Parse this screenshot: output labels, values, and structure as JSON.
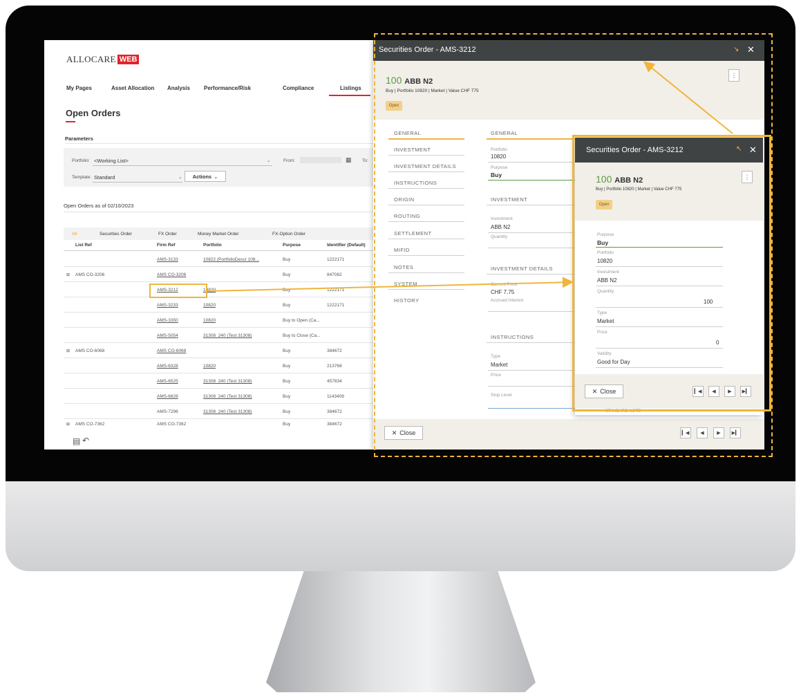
{
  "app": {
    "logo_text": "ALLOCARE",
    "logo_badge": "WEB",
    "nav": [
      "My Pages",
      "Asset Allocation",
      "Analysis",
      "Performance/Risk",
      "Compliance",
      "Listings"
    ],
    "page_title": "Open Orders",
    "parameters_label": "Parameters",
    "portfolio_label": "Portfolio:",
    "portfolio_value": "<Working List>",
    "template_label": "Template:",
    "template_value": "Standard",
    "actions_label": "Actions",
    "from_label": "From:",
    "to_label": "To:",
    "orders_as_of": "Open Orders as of 02/10/2023",
    "tabs": [
      "All",
      "Securities Order",
      "FX Order",
      "Money Market Order",
      "FX-Option Order"
    ],
    "columns": [
      "List Ref",
      "Firm Ref",
      "Portfolio",
      "Purpose",
      "Identifier (Default)"
    ],
    "rows": [
      {
        "list_ref": "",
        "firm_ref": "AMS-3133",
        "portfolio": "10822 (PortfolioDescr 108...",
        "purpose": "Buy",
        "identifier": "1222171"
      },
      {
        "list_ref": "AMS CO-3206",
        "firm_ref": "AMS CO-3206",
        "portfolio": "",
        "purpose": "Buy",
        "identifier": "847082"
      },
      {
        "list_ref": "",
        "firm_ref": "AMS-3212",
        "portfolio": "10820",
        "purpose": "Buy",
        "identifier": "1222171"
      },
      {
        "list_ref": "",
        "firm_ref": "AMS-3233",
        "portfolio": "10820",
        "purpose": "Buy",
        "identifier": "1222171"
      },
      {
        "list_ref": "",
        "firm_ref": "AMS-3350",
        "portfolio": "10820",
        "purpose": "Buy to Open (Ca...",
        "identifier": ""
      },
      {
        "list_ref": "",
        "firm_ref": "AMS-5054",
        "portfolio": "31308_240 (Test 31308)",
        "purpose": "Buy to Close (Ca...",
        "identifier": ""
      },
      {
        "list_ref": "AMS CO-6068",
        "firm_ref": "AMS CO-6068",
        "portfolio": "",
        "purpose": "Buy",
        "identifier": "384672"
      },
      {
        "list_ref": "",
        "firm_ref": "AMS-6328",
        "portfolio": "10820",
        "purpose": "Buy",
        "identifier": "213768"
      },
      {
        "list_ref": "",
        "firm_ref": "AMS-6525",
        "portfolio": "31308_240 (Test 31308)",
        "purpose": "Buy",
        "identifier": "457834"
      },
      {
        "list_ref": "",
        "firm_ref": "AMS-6828",
        "portfolio": "31308_240 (Test 31308)",
        "purpose": "Buy",
        "identifier": "1143409"
      },
      {
        "list_ref": "",
        "firm_ref": "AMS-7298",
        "portfolio": "31308_240 (Test 31308)",
        "purpose": "Buy",
        "identifier": "384672"
      },
      {
        "list_ref": "AMS CO-7362",
        "firm_ref": "AMS CO-7362",
        "portfolio": "",
        "purpose": "Buy",
        "identifier": "384672"
      }
    ]
  },
  "drawer_large": {
    "title": "Securities Order - AMS-3212",
    "qty": "100",
    "instrument": "ABB N2",
    "subtitle": "Buy | Portfolio 10820 | Market | Value CHF 775",
    "status": "Open",
    "sections": [
      "GENERAL",
      "INVESTMENT",
      "INVESTMENT DETAILS",
      "INSTRUCTIONS",
      "ORIGIN",
      "ROUTING",
      "SETTLEMENT",
      "MIFID",
      "NOTES",
      "SYSTEM",
      "HISTORY"
    ],
    "general_header": "GENERAL",
    "portfolio_label": "Portfolio",
    "portfolio_value": "10820",
    "purpose_label": "Purpose",
    "purpose_value": "Buy",
    "investment_header": "INVESTMENT",
    "investment_label": "Investment",
    "investment_value": "ABB N2",
    "quantity_label": "Quantity",
    "details_header": "INVESTMENT DETAILS",
    "current_price_label": "Current Price",
    "current_price_value": "CHF 7.75",
    "accrued_label": "Accrued Interest",
    "instructions_header": "INSTRUCTIONS",
    "type_label": "Type",
    "type_value": "Market",
    "price_label": "Price",
    "stop_label": "Stop Level",
    "close_label": "Close"
  },
  "drawer_small": {
    "title": "Securities Order - AMS-3212",
    "qty": "100",
    "instrument": "ABB N2",
    "subtitle": "Buy | Portfolio 10820 | Market | Value CHF 775",
    "status": "Open",
    "purpose_label": "Purpose",
    "purpose_value": "Buy",
    "portfolio_label": "Portfolio",
    "portfolio_value": "10820",
    "investment_label": "Investment",
    "investment_value": "ABB N2",
    "quantity_label": "Quantity",
    "quantity_value": "100",
    "type_label": "Type",
    "type_value": "Market",
    "price_label": "Price",
    "price_value": "0",
    "validity_label": "Validity",
    "validity_value": "Good for Day",
    "close_label": "Close",
    "peek_text": "STANDARD NOTE"
  },
  "colors": {
    "accent": "#f0b43c",
    "header": "#3f4344",
    "brand_red": "#e2232a",
    "green": "#5a9a3f"
  }
}
